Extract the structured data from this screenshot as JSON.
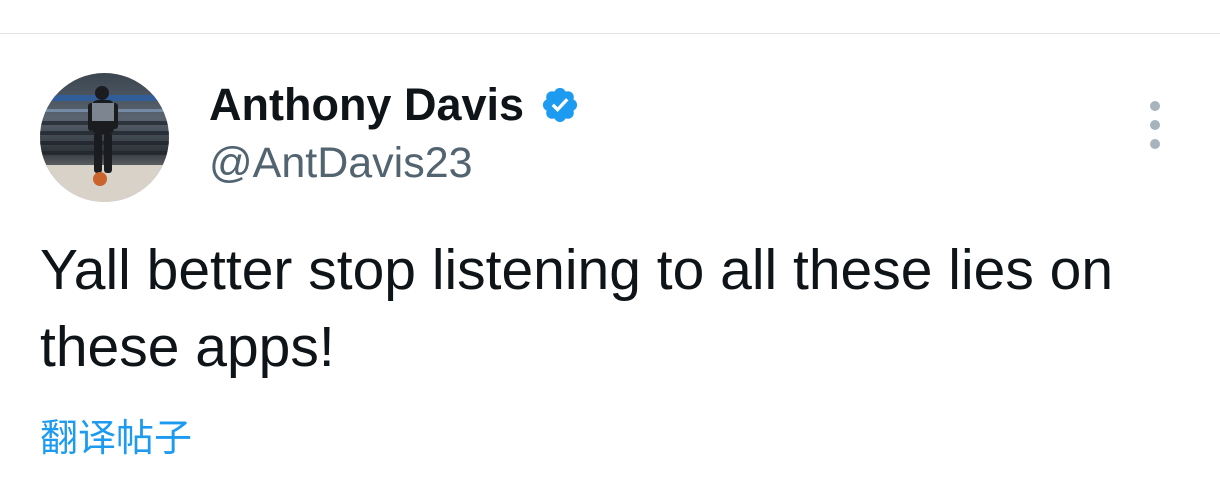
{
  "tweet": {
    "author": {
      "display_name": "Anthony Davis",
      "handle": "@AntDavis23",
      "verified": true,
      "avatar_icon": "profile-photo-basketball-player"
    },
    "text": "Yall better stop listening to all these lies on these apps!",
    "translate_label": "翻译帖子",
    "more_icon": "more-vertical-icon"
  },
  "colors": {
    "text_primary": "#0f1419",
    "text_secondary": "#536471",
    "link_blue": "#1d9bf0",
    "verified_blue": "#1d9bf0",
    "more_dots": "#a7b4bd",
    "divider": "#e1e6ea"
  }
}
